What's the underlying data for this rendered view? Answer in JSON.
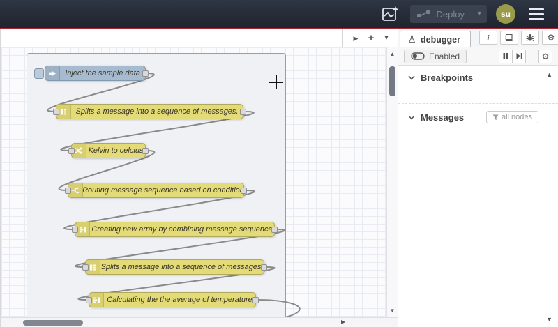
{
  "header": {
    "deploy_label": "Deploy",
    "avatar_initials": "su"
  },
  "icons": {
    "caret_down": "▾",
    "play_right": "▶",
    "plus": "+",
    "scroll_up": "▲",
    "scroll_down": "▼",
    "scroll_right": "▶",
    "info": "i",
    "gear": "⚙"
  },
  "colors": {
    "header_bg": "#2a3140",
    "accent_red": "#a22733",
    "node_yellow": "#e3db77",
    "node_inject_blue": "#a6bbcf",
    "avatar_olive": "#9a9a4b",
    "wire_gray": "#8a8a8a"
  },
  "flow": {
    "nodes": [
      {
        "type": "inject",
        "icon": "inject-arrow-icon",
        "label": "Inject the sample data"
      },
      {
        "type": "split",
        "icon": "split-icon",
        "label": "Splits a message into a sequence of messages."
      },
      {
        "type": "change",
        "icon": "shuffle-icon",
        "label": "Kelvin to celcius"
      },
      {
        "type": "switch",
        "icon": "fork-icon",
        "label": "Routing message sequence based on condition"
      },
      {
        "type": "join",
        "icon": "join-icon",
        "label": "Creating new array by combining message sequence"
      },
      {
        "type": "split",
        "icon": "split-icon",
        "label": "Splits a message into a sequence of messages."
      },
      {
        "type": "join",
        "icon": "join-icon",
        "label": "Calculating the the average of temperature"
      }
    ]
  },
  "sidebar": {
    "tab_label": "debugger",
    "toolbar": {
      "enabled_label": "Enabled"
    },
    "sections": [
      {
        "title": "Breakpoints"
      },
      {
        "title": "Messages",
        "filter_label": "all nodes"
      }
    ]
  }
}
